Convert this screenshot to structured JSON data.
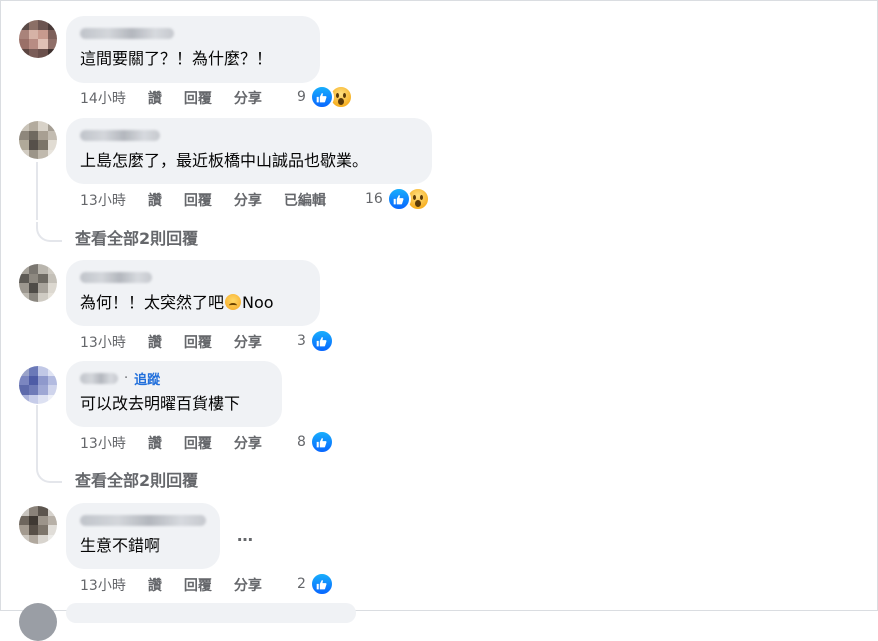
{
  "comments": [
    {
      "text": "這間要關了？！為什麼？！",
      "time": "14小時",
      "actions": [
        "讚",
        "回覆",
        "分享"
      ],
      "edited": "",
      "reaction_count": "9",
      "reactions": [
        "like-icon",
        "wow-icon"
      ]
    },
    {
      "text": "上島怎麼了，最近板橋中山誠品也歇業。",
      "time": "13小時",
      "actions": [
        "讚",
        "回覆",
        "分享"
      ],
      "edited": "已編輯",
      "reaction_count": "16",
      "reactions": [
        "like-icon",
        "wow-icon"
      ],
      "view_replies": "查看全部2則回覆"
    },
    {
      "text_before": "為何！！太突然了吧",
      "emoji": "crying-face-emoji",
      "text_after": "Noo",
      "time": "13小時",
      "actions": [
        "讚",
        "回覆",
        "分享"
      ],
      "reaction_count": "3",
      "reactions": [
        "like-icon"
      ]
    },
    {
      "separator": "·",
      "follow_label": "追蹤",
      "text": "可以改去明曜百貨樓下",
      "time": "13小時",
      "actions": [
        "讚",
        "回覆",
        "分享"
      ],
      "reaction_count": "8",
      "reactions": [
        "like-icon"
      ],
      "view_replies": "查看全部2則回覆"
    },
    {
      "text": "生意不錯啊",
      "more": "…",
      "time": "13小時",
      "actions": [
        "讚",
        "回覆",
        "分享"
      ],
      "reaction_count": "2",
      "reactions": [
        "like-icon"
      ]
    }
  ],
  "colors": {
    "bubble": "#f0f2f5",
    "meta": "#65676b",
    "like": "#0866ff",
    "follow": "#216fdb"
  }
}
